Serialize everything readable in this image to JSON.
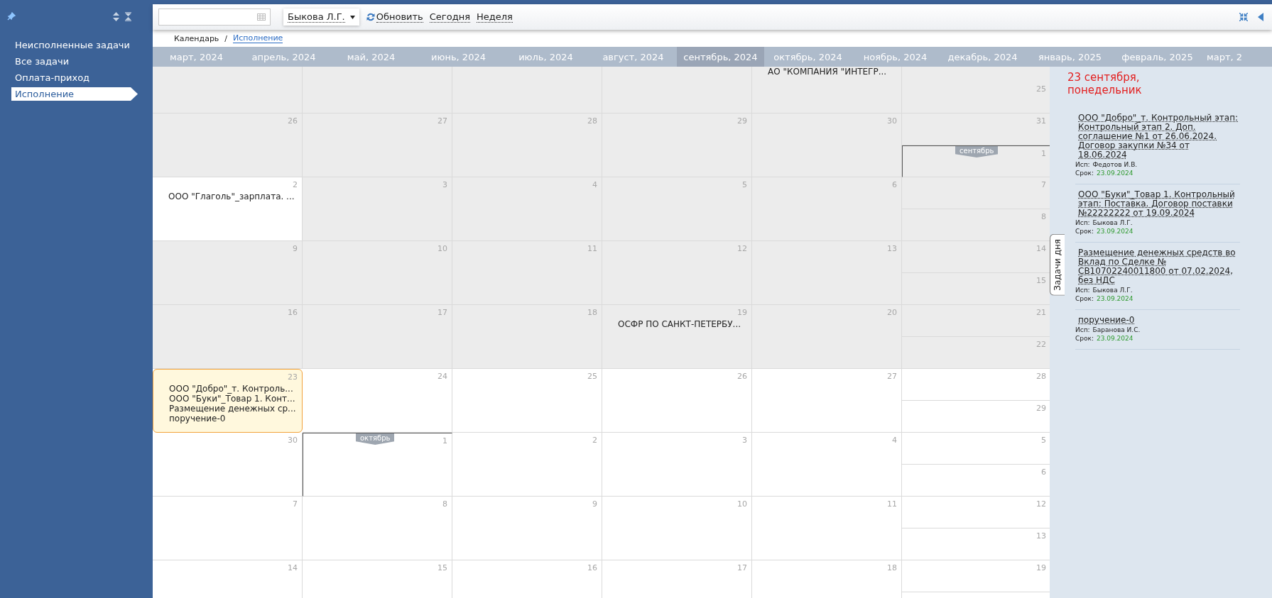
{
  "sidebar": {
    "items": [
      {
        "label": "Неисполненные задачи",
        "selected": false
      },
      {
        "label": "Все задачи",
        "selected": false
      },
      {
        "label": "Оплата-приход",
        "selected": false
      },
      {
        "label": "Исполнение",
        "selected": true
      }
    ]
  },
  "toolbar": {
    "user_select": "Быкова Л.Г.",
    "actions": [
      {
        "label": "Обновить",
        "kind": "refresh"
      },
      {
        "label": "Сегодня",
        "kind": "link"
      },
      {
        "label": "Неделя",
        "kind": "link"
      }
    ]
  },
  "breadcrumb": [
    {
      "label": "Календарь",
      "link": false
    },
    {
      "label": "/",
      "link": false
    },
    {
      "label": "Исполнение",
      "link": true
    }
  ],
  "months": [
    {
      "label": "март, 2024",
      "selected": false
    },
    {
      "label": "апрель, 2024",
      "selected": false
    },
    {
      "label": "май, 2024",
      "selected": false
    },
    {
      "label": "июнь, 2024",
      "selected": false
    },
    {
      "label": "июль, 2024",
      "selected": false
    },
    {
      "label": "август, 2024",
      "selected": false
    },
    {
      "label": "сентябрь, 2024",
      "selected": true
    },
    {
      "label": "октябрь, 2024",
      "selected": false
    },
    {
      "label": "ноябрь, 2024",
      "selected": false
    },
    {
      "label": "декабрь, 2024",
      "selected": false
    },
    {
      "label": "январь, 2025",
      "selected": false
    },
    {
      "label": "февраль, 2025",
      "selected": false
    },
    {
      "label": "март, 2",
      "selected": false
    }
  ],
  "weeks": [
    {
      "days": [
        {
          "past": true,
          "selected": false
        },
        {
          "past": true,
          "selected": false
        },
        {
          "past": true,
          "selected": false
        },
        {
          "past": true,
          "selected": false
        },
        {
          "past": true,
          "selected": false,
          "events": [
            "АО \"КОМПАНИЯ \"ИНТЕГР..."
          ]
        }
      ],
      "weekend": [
        {
          "day": "25",
          "past": true,
          "selected": false
        }
      ]
    },
    {
      "days": [
        {
          "day": "26",
          "past": true,
          "selected": false
        },
        {
          "day": "27",
          "past": true,
          "selected": false
        },
        {
          "day": "28",
          "past": true,
          "selected": false
        },
        {
          "day": "29",
          "past": true,
          "selected": false
        },
        {
          "day": "30",
          "past": true,
          "selected": false
        }
      ],
      "weekend": [
        {
          "day": "31",
          "past": true,
          "selected": false
        },
        {
          "day": "1",
          "past": true,
          "selected": false,
          "month_label": "сентябрь"
        }
      ]
    },
    {
      "days": [
        {
          "day": "2",
          "past": false,
          "selected": false,
          "events": [
            "ООО \"Глаголь\"_зарплата. ..."
          ]
        },
        {
          "day": "3",
          "past": true,
          "selected": false
        },
        {
          "day": "4",
          "past": true,
          "selected": false
        },
        {
          "day": "5",
          "past": true,
          "selected": false
        },
        {
          "day": "6",
          "past": true,
          "selected": false
        }
      ],
      "weekend": [
        {
          "day": "7",
          "past": true,
          "selected": false
        },
        {
          "day": "8",
          "past": true,
          "selected": false
        }
      ]
    },
    {
      "days": [
        {
          "day": "9",
          "past": true,
          "selected": false
        },
        {
          "day": "10",
          "past": true,
          "selected": false
        },
        {
          "day": "11",
          "past": true,
          "selected": false
        },
        {
          "day": "12",
          "past": true,
          "selected": false
        },
        {
          "day": "13",
          "past": true,
          "selected": false
        }
      ],
      "weekend": [
        {
          "day": "14",
          "past": true,
          "selected": false
        },
        {
          "day": "15",
          "past": true,
          "selected": false
        }
      ]
    },
    {
      "days": [
        {
          "day": "16",
          "past": true,
          "selected": false
        },
        {
          "day": "17",
          "past": true,
          "selected": false
        },
        {
          "day": "18",
          "past": true,
          "selected": false
        },
        {
          "day": "19",
          "past": true,
          "selected": false,
          "events": [
            "ОСФР ПО САНКТ-ПЕТЕРБУ..."
          ]
        },
        {
          "day": "20",
          "past": true,
          "selected": false
        }
      ],
      "weekend": [
        {
          "day": "21",
          "past": true,
          "selected": false
        },
        {
          "day": "22",
          "past": true,
          "selected": false
        }
      ]
    },
    {
      "days": [
        {
          "day": "23",
          "past": false,
          "selected": true,
          "events": [
            "ООО \"Добро\"_т. Контроль...",
            "ООО \"Буки\"_Товар 1. Конт...",
            "Размещение денежных ср...",
            "поручение-0"
          ]
        },
        {
          "day": "24",
          "past": false,
          "selected": false
        },
        {
          "day": "25",
          "past": false,
          "selected": false
        },
        {
          "day": "26",
          "past": false,
          "selected": false
        },
        {
          "day": "27",
          "past": false,
          "selected": false
        }
      ],
      "weekend": [
        {
          "day": "28",
          "past": false,
          "selected": false
        },
        {
          "day": "29",
          "past": false,
          "selected": false
        }
      ]
    },
    {
      "days": [
        {
          "day": "30",
          "past": false,
          "selected": false
        },
        {
          "day": "1",
          "past": false,
          "selected": false,
          "month_label": "октябрь"
        },
        {
          "day": "2",
          "past": false,
          "selected": false
        },
        {
          "day": "3",
          "past": false,
          "selected": false
        },
        {
          "day": "4",
          "past": false,
          "selected": false
        }
      ],
      "weekend": [
        {
          "day": "5",
          "past": false,
          "selected": false
        },
        {
          "day": "6",
          "past": false,
          "selected": false
        }
      ]
    },
    {
      "days": [
        {
          "day": "7",
          "past": false,
          "selected": false
        },
        {
          "day": "8",
          "past": false,
          "selected": false
        },
        {
          "day": "9",
          "past": false,
          "selected": false
        },
        {
          "day": "10",
          "past": false,
          "selected": false
        },
        {
          "day": "11",
          "past": false,
          "selected": false
        }
      ],
      "weekend": [
        {
          "day": "12",
          "past": false,
          "selected": false
        },
        {
          "day": "13",
          "past": false,
          "selected": false
        }
      ]
    },
    {
      "days": [
        {
          "day": "14",
          "past": false,
          "selected": false
        },
        {
          "day": "15",
          "past": false,
          "selected": false
        },
        {
          "day": "16",
          "past": false,
          "selected": false
        },
        {
          "day": "17",
          "past": false,
          "selected": false
        },
        {
          "day": "18",
          "past": false,
          "selected": false
        }
      ],
      "weekend": [
        {
          "day": "19",
          "past": false,
          "selected": false
        }
      ]
    }
  ],
  "day_panel": {
    "tab": "Задачи дня",
    "date": "23 сентября, понедельник",
    "tasks": [
      {
        "title": "ООО \"Добро\"_т. Контрольный этап: Контрольный этап 2. Доп. соглашение №1 от 26.06.2024. Договор закупки №34 от 18.06.2024",
        "assignee_label": "Исп:",
        "assignee": "Федотов И.В.",
        "due_label": "Срок:",
        "due": "23.09.2024"
      },
      {
        "title": "ООО \"Буки\"_Товар 1. Контрольный этап: Поставка. Договор поставки №22222222 от 19.09.2024",
        "assignee_label": "Исп:",
        "assignee": "Быкова Л.Г.",
        "due_label": "Срок:",
        "due": "23.09.2024"
      },
      {
        "title": "Размещение денежных средств во Вклад по Сделке № СВ10702240011800 от 07.02.2024, без НДС",
        "assignee_label": "Исп:",
        "assignee": "Быкова Л.Г.",
        "due_label": "Срок:",
        "due": "23.09.2024"
      },
      {
        "title": "поручение-0",
        "assignee_label": "Исп:",
        "assignee": "Баранова И.С.",
        "due_label": "Срок:",
        "due": "23.09.2024"
      }
    ]
  }
}
